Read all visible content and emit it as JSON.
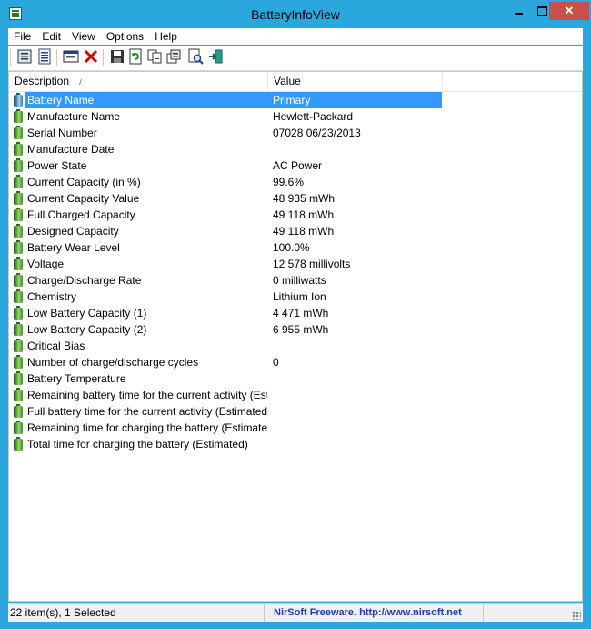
{
  "window": {
    "title": "BatteryInfoView"
  },
  "menu": [
    {
      "label": "File"
    },
    {
      "label": "Edit"
    },
    {
      "label": "View"
    },
    {
      "label": "Options"
    },
    {
      "label": "Help"
    }
  ],
  "toolbar": {
    "buttons": [
      {
        "icon": "properties-icon"
      },
      {
        "icon": "list-view-icon"
      },
      {
        "icon": "window-icon"
      },
      {
        "icon": "delete-icon"
      },
      {
        "icon": "save-icon"
      },
      {
        "icon": "refresh-icon"
      },
      {
        "icon": "copy-icon"
      },
      {
        "icon": "options-icon"
      },
      {
        "icon": "find-icon"
      },
      {
        "icon": "exit-icon"
      }
    ]
  },
  "columns": {
    "description": "Description",
    "value": "Value"
  },
  "rows": [
    {
      "description": "Battery Name",
      "value": "Primary",
      "selected": true
    },
    {
      "description": "Manufacture Name",
      "value": "Hewlett-Packard"
    },
    {
      "description": "Serial Number",
      "value": "07028 06/23/2013"
    },
    {
      "description": "Manufacture Date",
      "value": ""
    },
    {
      "description": "Power State",
      "value": "AC Power"
    },
    {
      "description": "Current Capacity (in %)",
      "value": "99.6%"
    },
    {
      "description": "Current Capacity Value",
      "value": "48 935 mWh"
    },
    {
      "description": "Full Charged Capacity",
      "value": "49 118 mWh"
    },
    {
      "description": "Designed Capacity",
      "value": "49 118 mWh"
    },
    {
      "description": "Battery Wear Level",
      "value": "100.0%"
    },
    {
      "description": "Voltage",
      "value": "12 578 millivolts"
    },
    {
      "description": "Charge/Discharge Rate",
      "value": "0 milliwatts"
    },
    {
      "description": "Chemistry",
      "value": "Lithium Ion"
    },
    {
      "description": "Low Battery Capacity (1)",
      "value": "4 471 mWh"
    },
    {
      "description": "Low Battery Capacity (2)",
      "value": "6 955 mWh"
    },
    {
      "description": "Critical Bias",
      "value": ""
    },
    {
      "description": "Number of charge/discharge cycles",
      "value": "0"
    },
    {
      "description": "Battery Temperature",
      "value": ""
    },
    {
      "description": "Remaining battery time for the current activity (Est...",
      "value": ""
    },
    {
      "description": "Full battery time for the current activity (Estimated)",
      "value": ""
    },
    {
      "description": "Remaining time for charging the battery (Estimated)",
      "value": ""
    },
    {
      "description": "Total  time for charging the battery (Estimated)",
      "value": ""
    }
  ],
  "status": {
    "items": "22 item(s), 1 Selected",
    "credit": "NirSoft Freeware.  http://www.nirsoft.net"
  },
  "colors": {
    "titlebar": "#2aa7dd",
    "selection": "#3399ff",
    "close": "#c7504b",
    "credit": "#1a3cba"
  }
}
